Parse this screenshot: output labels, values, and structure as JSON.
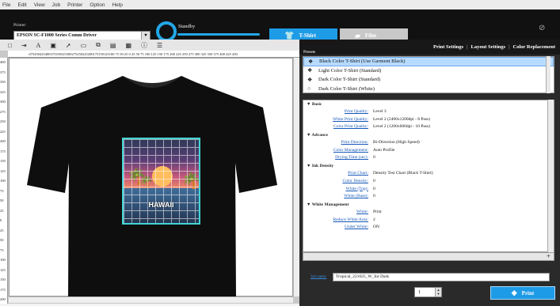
{
  "menu": [
    "File",
    "Edit",
    "View",
    "Job",
    "Printer",
    "Option",
    "Help"
  ],
  "header": {
    "printer_label": "Printer:",
    "printer_value": "EPSON SC-F1000 Series Comm Driver",
    "status": "Standby",
    "tab_tshirt": "T-Shirt",
    "tab_film": "Film"
  },
  "ruler": {
    "h": "-475450425400375350325300275250225200175150125100 75 50 25  0  25  50  75  100 125 150 175 200 225 250 275 300 325 350 375 400 425 450",
    "v": [
      "400",
      "375",
      "350",
      "325",
      "300",
      "275",
      "250",
      "225",
      "200",
      "175",
      "150",
      "125",
      "100",
      "75",
      "50",
      "25",
      "0",
      "25",
      "50",
      "75",
      "100",
      "125",
      "150",
      "175",
      "200",
      "225",
      "250",
      "275",
      "300",
      "325",
      "350",
      "375",
      "400"
    ]
  },
  "design": {
    "text": "HAWAII"
  },
  "right_tabs": [
    "Print Settings",
    "Layout Settings",
    "Color Replacement"
  ],
  "presets": {
    "label": "Presets",
    "items": [
      {
        "label": "Black Color T-Shirt (Use Garment Black)",
        "icon": "color-drops-icon"
      },
      {
        "label": "Light Color T-Shirt (Standard)",
        "icon": "color-drops-icon"
      },
      {
        "label": "Dark Color T-Shirt (Standard)",
        "icon": "color-drops-icon"
      },
      {
        "label": "Dark Color T-Shirt (White)",
        "icon": "circle-icon"
      }
    ]
  },
  "settings": [
    {
      "section": "Basic",
      "rows": [
        {
          "k": "Print Quality:",
          "v": "Level 3"
        },
        {
          "k": "White Print Quality:",
          "v": "Level 2 (2400x1200dpi - 8 Pass)"
        },
        {
          "k": "Color Print Quality:",
          "v": "Level 2 (1200x600dpi - 10 Pass)"
        }
      ]
    },
    {
      "section": "Advance",
      "rows": [
        {
          "k": "Print Direction:",
          "v": "Bi-Direction (High Speed)"
        },
        {
          "k": "Color Management:",
          "v": "Auto Profile"
        },
        {
          "k": "Drying Time (sec):",
          "v": "0"
        }
      ]
    },
    {
      "section": "Ink Density",
      "rows": [
        {
          "k": "Print Chart:",
          "v": "Density Test Chart (Black T-Shirt)"
        },
        {
          "k": "Color Density:",
          "v": "0"
        },
        {
          "k": "White (Top):",
          "v": "0"
        },
        {
          "k": "White (Base):",
          "v": "0"
        }
      ]
    },
    {
      "section": "White Management",
      "rows": [
        {
          "k": "White:",
          "v": "Print"
        },
        {
          "k": "Reduce White Area:",
          "v": "2"
        },
        {
          "k": "Under White:",
          "v": "ON"
        }
      ]
    }
  ],
  "job": {
    "label": "Job name:",
    "value": "Tropical_221025_W_for Dark"
  },
  "copies": "1",
  "print_label": "Print"
}
